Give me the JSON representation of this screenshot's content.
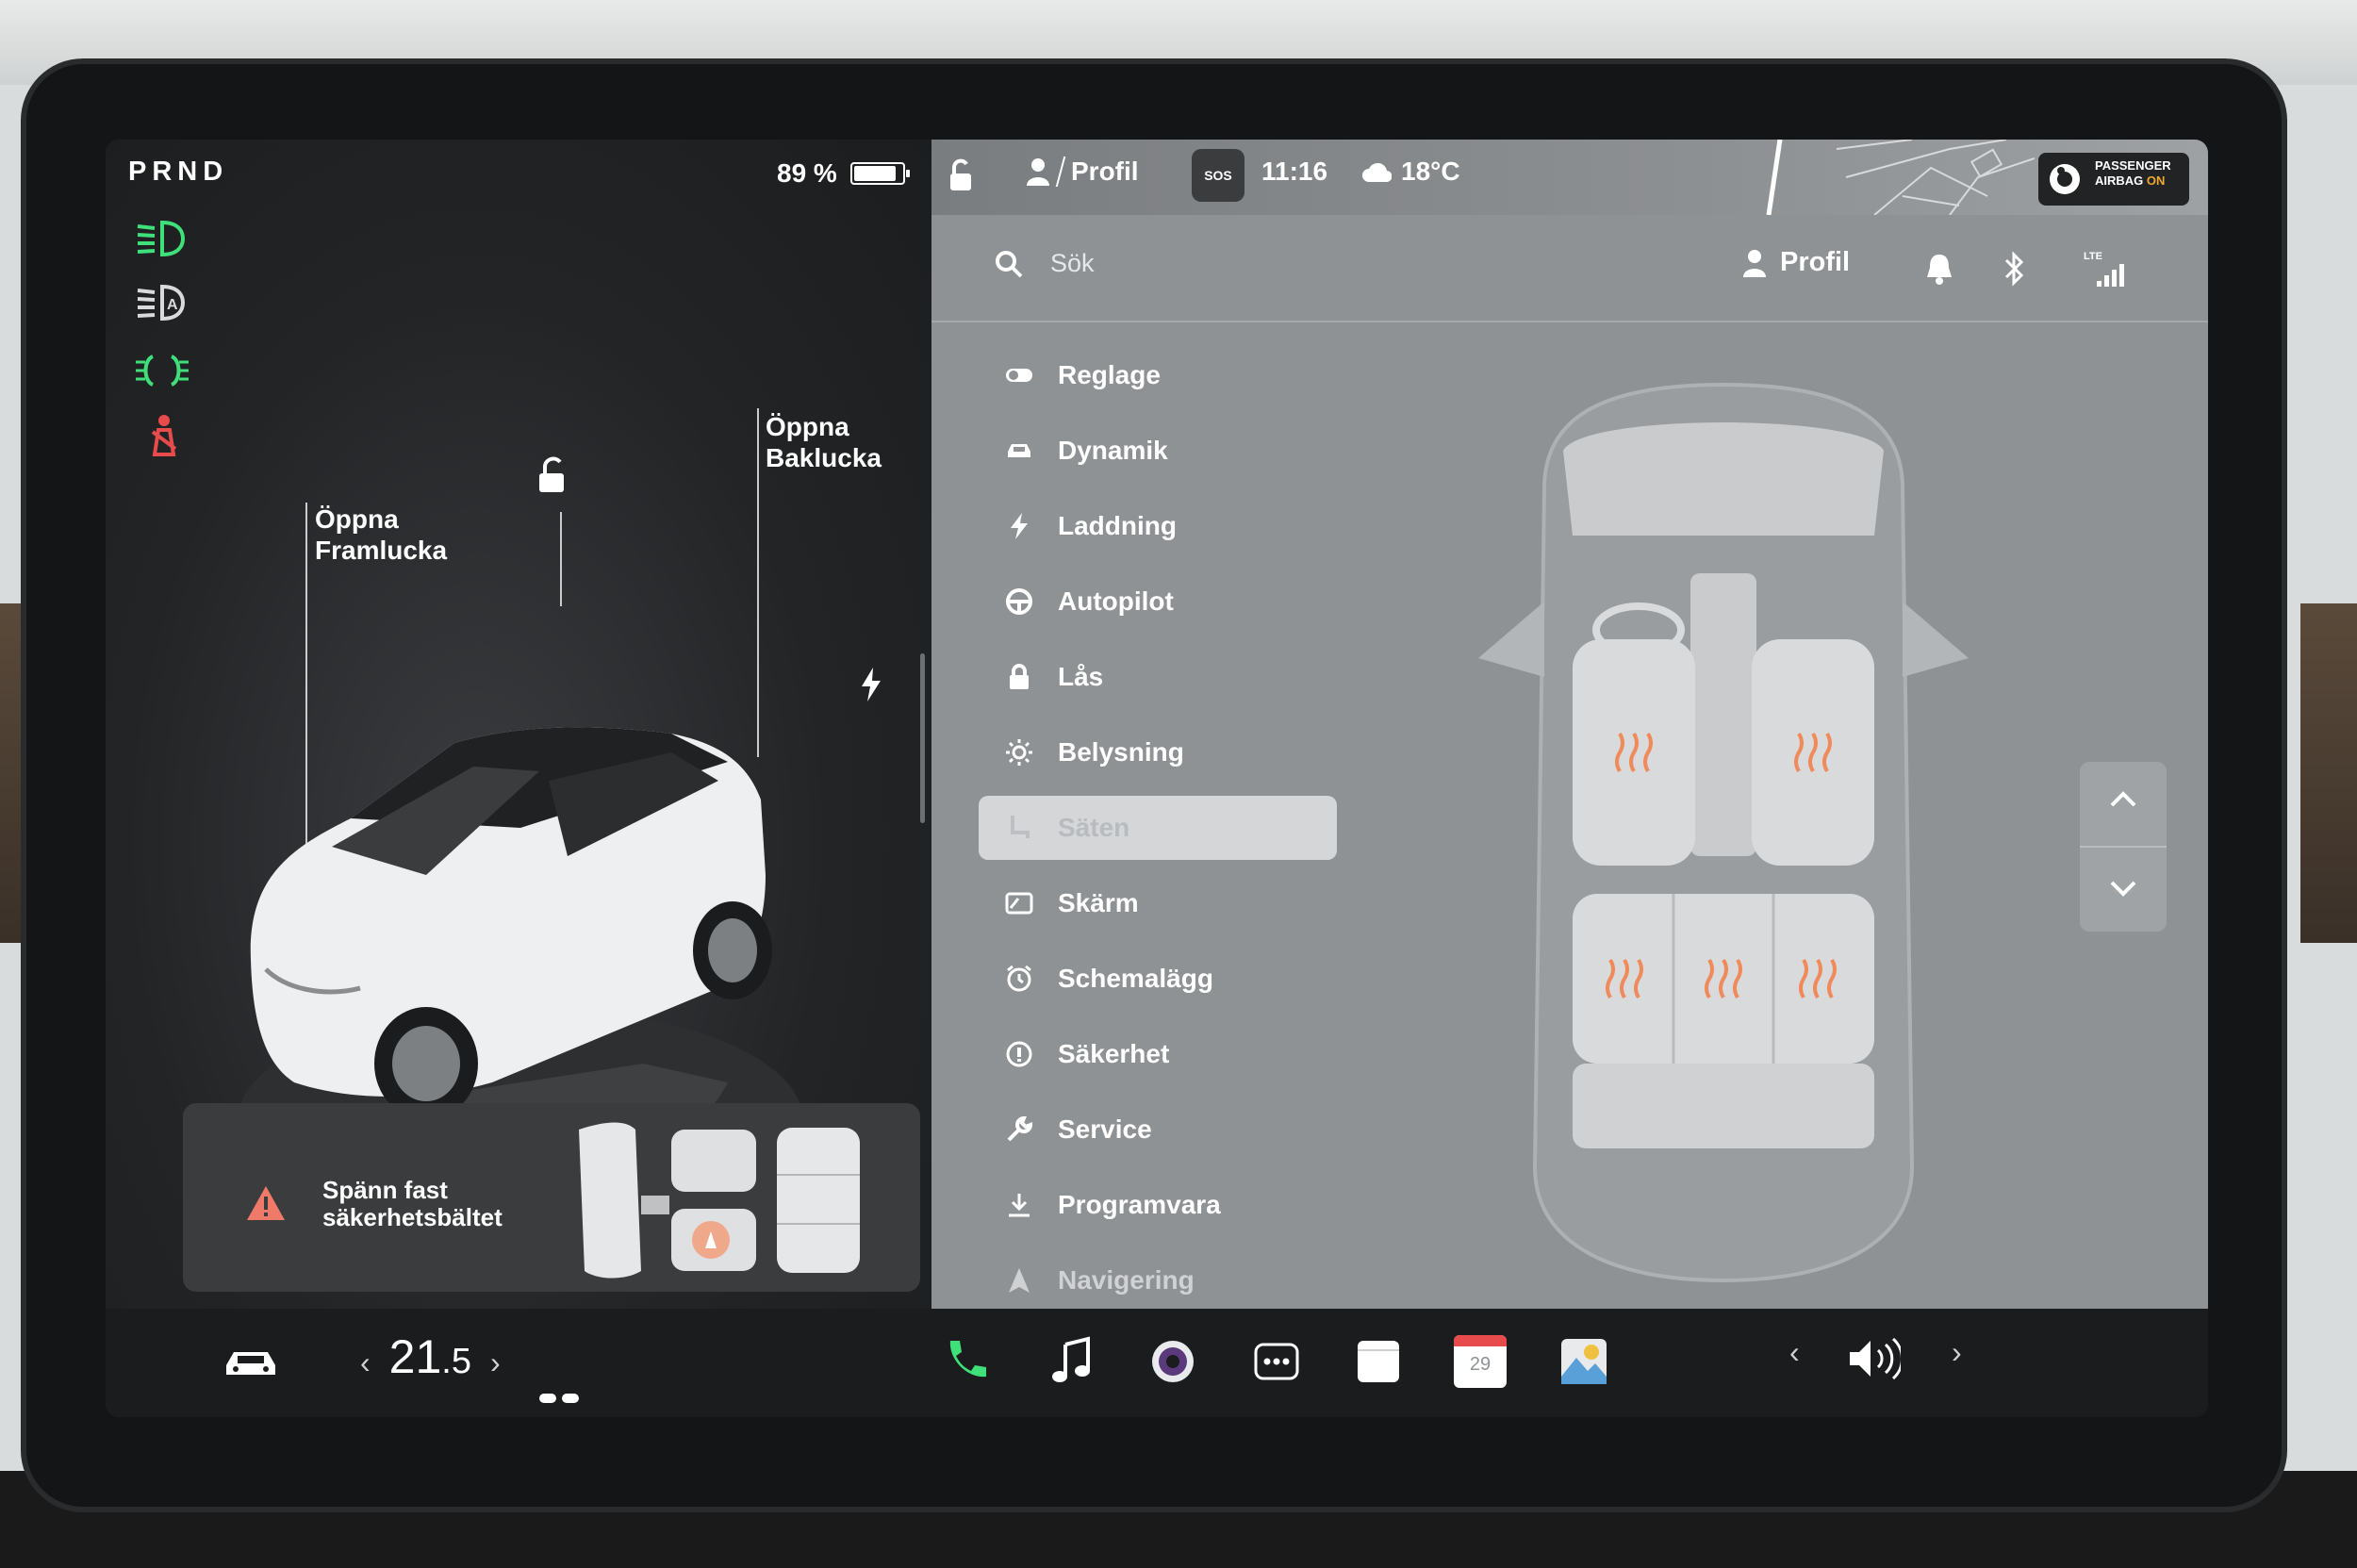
{
  "status": {
    "gear": "PRND",
    "battery_percent_label": "89 %",
    "battery_level": 0.89
  },
  "callouts": {
    "frunk": "Öppna\nFramlucka",
    "trunk": "Öppna\nBaklucka"
  },
  "alert": {
    "seatbelt_text": "Spänn fast\nsäkerhetsbältet"
  },
  "topbar": {
    "profile_label": "Profil",
    "sos_label": "SOS",
    "time": "11:16",
    "outside_temp": "18°C",
    "airbag_line1": "PASSENGER",
    "airbag_line2": "AIRBAG",
    "airbag_state": "ON"
  },
  "search": {
    "placeholder": "Sök",
    "profile_label": "Profil",
    "network_label": "LTE"
  },
  "menu": [
    {
      "label": "Reglage",
      "icon": "toggle-icon"
    },
    {
      "label": "Dynamik",
      "icon": "car-icon"
    },
    {
      "label": "Laddning",
      "icon": "lightning-icon"
    },
    {
      "label": "Autopilot",
      "icon": "steering-wheel-icon"
    },
    {
      "label": "Lås",
      "icon": "lock-icon"
    },
    {
      "label": "Belysning",
      "icon": "sun-icon"
    },
    {
      "label": "Säten",
      "icon": "seat-icon"
    },
    {
      "label": "Skärm",
      "icon": "display-icon"
    },
    {
      "label": "Schemalägg",
      "icon": "alarm-clock-icon"
    },
    {
      "label": "Säkerhet",
      "icon": "warning-circle-icon"
    },
    {
      "label": "Service",
      "icon": "wrench-icon"
    },
    {
      "label": "Programvara",
      "icon": "download-icon"
    },
    {
      "label": "Navigering",
      "icon": "navigation-icon"
    }
  ],
  "dock": {
    "cabin_temp_whole": "21",
    "cabin_temp_decimal": ".5",
    "calendar_day": "29"
  },
  "colors": {
    "tell_green": "#3fe07a",
    "tell_red": "#e84b4b",
    "heat_orange": "#f08a5a"
  }
}
